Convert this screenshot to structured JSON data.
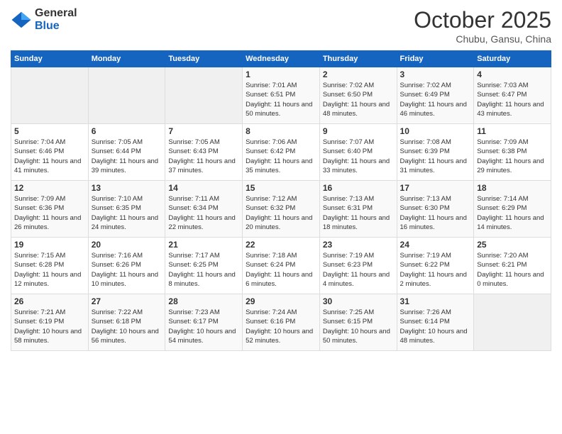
{
  "header": {
    "logo_general": "General",
    "logo_blue": "Blue",
    "month": "October 2025",
    "location": "Chubu, Gansu, China"
  },
  "weekdays": [
    "Sunday",
    "Monday",
    "Tuesday",
    "Wednesday",
    "Thursday",
    "Friday",
    "Saturday"
  ],
  "weeks": [
    [
      {
        "day": "",
        "info": ""
      },
      {
        "day": "",
        "info": ""
      },
      {
        "day": "",
        "info": ""
      },
      {
        "day": "1",
        "info": "Sunrise: 7:01 AM\nSunset: 6:51 PM\nDaylight: 11 hours\nand 50 minutes."
      },
      {
        "day": "2",
        "info": "Sunrise: 7:02 AM\nSunset: 6:50 PM\nDaylight: 11 hours\nand 48 minutes."
      },
      {
        "day": "3",
        "info": "Sunrise: 7:02 AM\nSunset: 6:49 PM\nDaylight: 11 hours\nand 46 minutes."
      },
      {
        "day": "4",
        "info": "Sunrise: 7:03 AM\nSunset: 6:47 PM\nDaylight: 11 hours\nand 43 minutes."
      }
    ],
    [
      {
        "day": "5",
        "info": "Sunrise: 7:04 AM\nSunset: 6:46 PM\nDaylight: 11 hours\nand 41 minutes."
      },
      {
        "day": "6",
        "info": "Sunrise: 7:05 AM\nSunset: 6:44 PM\nDaylight: 11 hours\nand 39 minutes."
      },
      {
        "day": "7",
        "info": "Sunrise: 7:05 AM\nSunset: 6:43 PM\nDaylight: 11 hours\nand 37 minutes."
      },
      {
        "day": "8",
        "info": "Sunrise: 7:06 AM\nSunset: 6:42 PM\nDaylight: 11 hours\nand 35 minutes."
      },
      {
        "day": "9",
        "info": "Sunrise: 7:07 AM\nSunset: 6:40 PM\nDaylight: 11 hours\nand 33 minutes."
      },
      {
        "day": "10",
        "info": "Sunrise: 7:08 AM\nSunset: 6:39 PM\nDaylight: 11 hours\nand 31 minutes."
      },
      {
        "day": "11",
        "info": "Sunrise: 7:09 AM\nSunset: 6:38 PM\nDaylight: 11 hours\nand 29 minutes."
      }
    ],
    [
      {
        "day": "12",
        "info": "Sunrise: 7:09 AM\nSunset: 6:36 PM\nDaylight: 11 hours\nand 26 minutes."
      },
      {
        "day": "13",
        "info": "Sunrise: 7:10 AM\nSunset: 6:35 PM\nDaylight: 11 hours\nand 24 minutes."
      },
      {
        "day": "14",
        "info": "Sunrise: 7:11 AM\nSunset: 6:34 PM\nDaylight: 11 hours\nand 22 minutes."
      },
      {
        "day": "15",
        "info": "Sunrise: 7:12 AM\nSunset: 6:32 PM\nDaylight: 11 hours\nand 20 minutes."
      },
      {
        "day": "16",
        "info": "Sunrise: 7:13 AM\nSunset: 6:31 PM\nDaylight: 11 hours\nand 18 minutes."
      },
      {
        "day": "17",
        "info": "Sunrise: 7:13 AM\nSunset: 6:30 PM\nDaylight: 11 hours\nand 16 minutes."
      },
      {
        "day": "18",
        "info": "Sunrise: 7:14 AM\nSunset: 6:29 PM\nDaylight: 11 hours\nand 14 minutes."
      }
    ],
    [
      {
        "day": "19",
        "info": "Sunrise: 7:15 AM\nSunset: 6:28 PM\nDaylight: 11 hours\nand 12 minutes."
      },
      {
        "day": "20",
        "info": "Sunrise: 7:16 AM\nSunset: 6:26 PM\nDaylight: 11 hours\nand 10 minutes."
      },
      {
        "day": "21",
        "info": "Sunrise: 7:17 AM\nSunset: 6:25 PM\nDaylight: 11 hours\nand 8 minutes."
      },
      {
        "day": "22",
        "info": "Sunrise: 7:18 AM\nSunset: 6:24 PM\nDaylight: 11 hours\nand 6 minutes."
      },
      {
        "day": "23",
        "info": "Sunrise: 7:19 AM\nSunset: 6:23 PM\nDaylight: 11 hours\nand 4 minutes."
      },
      {
        "day": "24",
        "info": "Sunrise: 7:19 AM\nSunset: 6:22 PM\nDaylight: 11 hours\nand 2 minutes."
      },
      {
        "day": "25",
        "info": "Sunrise: 7:20 AM\nSunset: 6:21 PM\nDaylight: 11 hours\nand 0 minutes."
      }
    ],
    [
      {
        "day": "26",
        "info": "Sunrise: 7:21 AM\nSunset: 6:19 PM\nDaylight: 10 hours\nand 58 minutes."
      },
      {
        "day": "27",
        "info": "Sunrise: 7:22 AM\nSunset: 6:18 PM\nDaylight: 10 hours\nand 56 minutes."
      },
      {
        "day": "28",
        "info": "Sunrise: 7:23 AM\nSunset: 6:17 PM\nDaylight: 10 hours\nand 54 minutes."
      },
      {
        "day": "29",
        "info": "Sunrise: 7:24 AM\nSunset: 6:16 PM\nDaylight: 10 hours\nand 52 minutes."
      },
      {
        "day": "30",
        "info": "Sunrise: 7:25 AM\nSunset: 6:15 PM\nDaylight: 10 hours\nand 50 minutes."
      },
      {
        "day": "31",
        "info": "Sunrise: 7:26 AM\nSunset: 6:14 PM\nDaylight: 10 hours\nand 48 minutes."
      },
      {
        "day": "",
        "info": ""
      }
    ]
  ]
}
